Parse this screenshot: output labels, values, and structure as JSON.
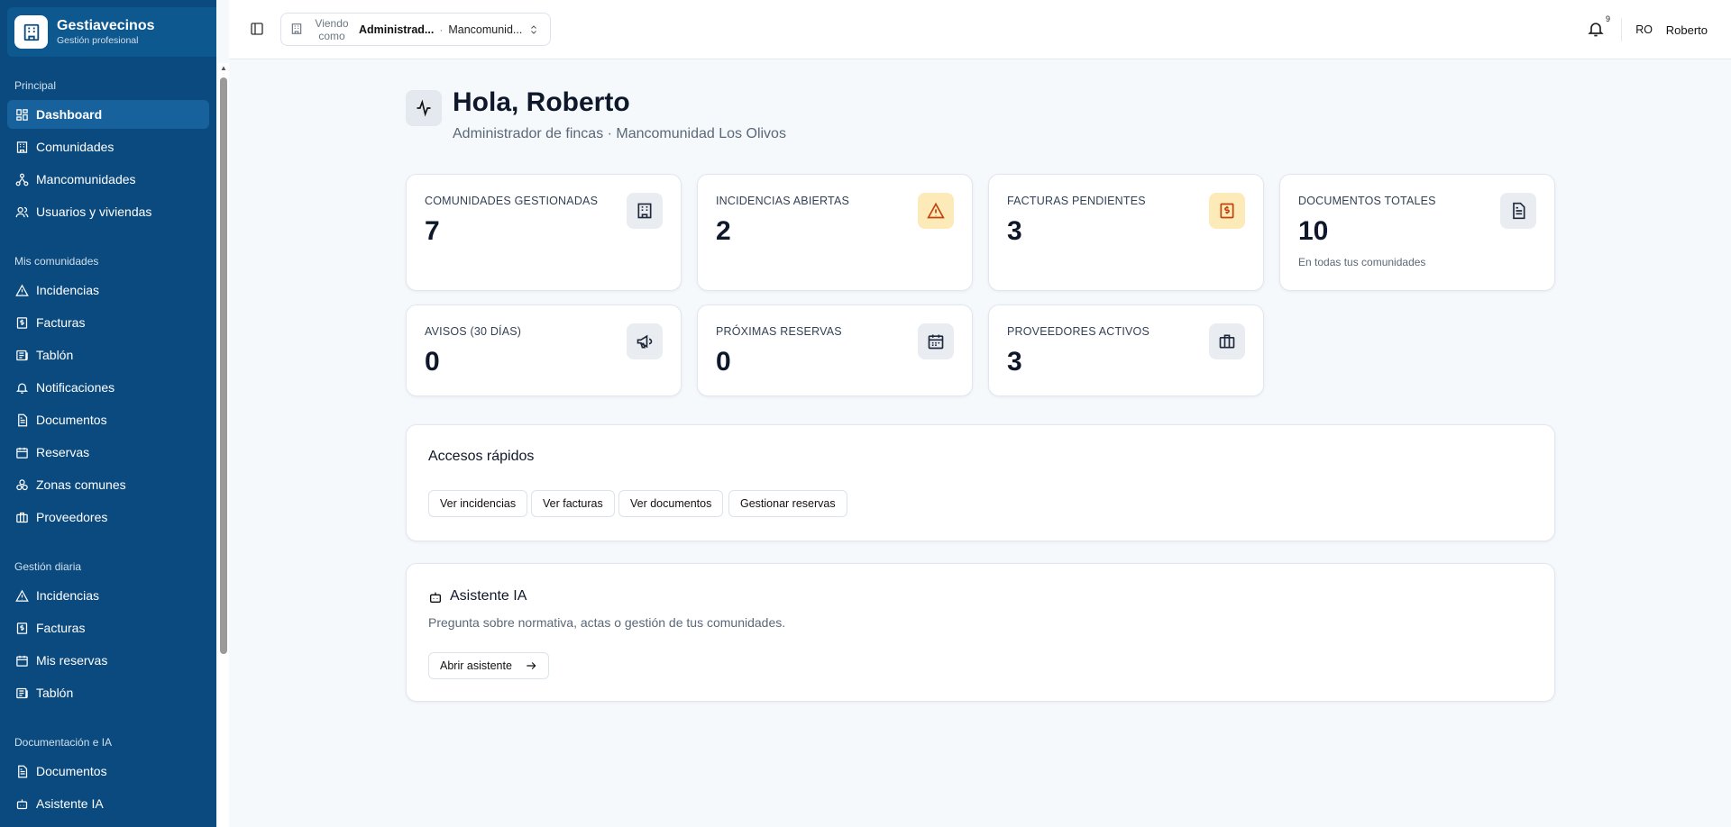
{
  "brand": {
    "name": "Gestiavecinos",
    "subtitle": "Gestión profesional"
  },
  "sidebar": {
    "sections": [
      {
        "label": "Principal",
        "items": [
          {
            "label": "Dashboard",
            "icon": "dashboard-icon",
            "active": true
          },
          {
            "label": "Comunidades",
            "icon": "building-icon"
          },
          {
            "label": "Mancomunidades",
            "icon": "network-icon"
          },
          {
            "label": "Usuarios y viviendas",
            "icon": "users-icon"
          }
        ]
      },
      {
        "label": "Mis comunidades",
        "items": [
          {
            "label": "Incidencias",
            "icon": "warning-icon"
          },
          {
            "label": "Facturas",
            "icon": "invoice-icon"
          },
          {
            "label": "Tablón",
            "icon": "newspaper-icon"
          },
          {
            "label": "Notificaciones",
            "icon": "bell-icon"
          },
          {
            "label": "Documentos",
            "icon": "document-icon"
          },
          {
            "label": "Reservas",
            "icon": "calendar-icon"
          },
          {
            "label": "Zonas comunes",
            "icon": "shapes-icon"
          },
          {
            "label": "Proveedores",
            "icon": "briefcase-icon"
          }
        ]
      },
      {
        "label": "Gestión diaria",
        "items": [
          {
            "label": "Incidencias",
            "icon": "warning-icon"
          },
          {
            "label": "Facturas",
            "icon": "invoice-icon"
          },
          {
            "label": "Mis reservas",
            "icon": "calendar-icon"
          },
          {
            "label": "Tablón",
            "icon": "newspaper-icon"
          }
        ]
      },
      {
        "label": "Documentación e IA",
        "items": [
          {
            "label": "Documentos",
            "icon": "document-icon"
          },
          {
            "label": "Asistente IA",
            "icon": "bot-icon"
          }
        ]
      }
    ]
  },
  "topbar": {
    "viewing_label": "Viendo como",
    "viewing_role": "Administrad...",
    "viewing_separator": "·",
    "viewing_entity": "Mancomunid...",
    "notification_count": "9",
    "avatar_initials": "RO",
    "user_name": "Roberto"
  },
  "header": {
    "title": "Hola, Roberto",
    "subtitle": "Administrador de fincas · Mancomunidad Los Olivos"
  },
  "stats": [
    {
      "label": "COMUNIDADES GESTIONADAS",
      "value": "7",
      "note": "",
      "icon": "building-icon",
      "tone": "gray"
    },
    {
      "label": "INCIDENCIAS ABIERTAS",
      "value": "2",
      "note": "",
      "icon": "warning-icon",
      "tone": "warn"
    },
    {
      "label": "FACTURAS PENDIENTES",
      "value": "3",
      "note": "",
      "icon": "invoice-icon",
      "tone": "warn"
    },
    {
      "label": "DOCUMENTOS TOTALES",
      "value": "10",
      "note": "En todas tus comunidades",
      "icon": "document-icon",
      "tone": "gray"
    },
    {
      "label": "AVISOS (30 DÍAS)",
      "value": "0",
      "note": "",
      "icon": "megaphone-icon",
      "tone": "gray"
    },
    {
      "label": "PRÓXIMAS RESERVAS",
      "value": "0",
      "note": "",
      "icon": "calendar-icon",
      "tone": "gray"
    },
    {
      "label": "PROVEEDORES ACTIVOS",
      "value": "3",
      "note": "",
      "icon": "briefcase-icon",
      "tone": "gray"
    }
  ],
  "quick_access": {
    "title": "Accesos rápidos",
    "buttons": [
      "Ver incidencias",
      "Ver facturas",
      "Ver documentos",
      "Gestionar reservas"
    ]
  },
  "assistant": {
    "title": "Asistente IA",
    "description": "Pregunta sobre normativa, actas o gestión de tus comunidades.",
    "button": "Abrir asistente"
  },
  "colors": {
    "sidebar_bg": "#0b4a7e",
    "sidebar_active": "#17629d",
    "page_bg": "#f5f9fc",
    "warn_bg": "#fcebb9",
    "warn_fg": "#c2410c"
  }
}
